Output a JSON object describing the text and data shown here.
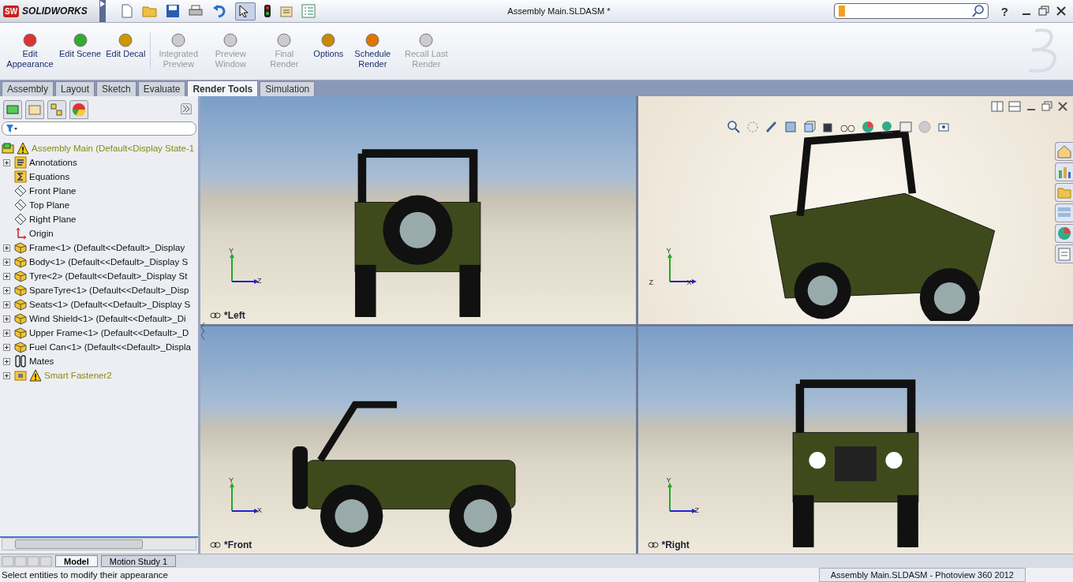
{
  "app": {
    "logo_mark": "SW",
    "logo": "SOLIDWORKS"
  },
  "window": {
    "title": "Assembly Main.SLDASM *",
    "help": "?"
  },
  "ribbon": [
    {
      "label": "Edit Appearance",
      "kind": "appearance",
      "disabled": false
    },
    {
      "label": "Edit Scene",
      "kind": "scene",
      "disabled": false
    },
    {
      "label": "Edit Decal",
      "kind": "decal",
      "disabled": false
    },
    {
      "label": "Integrated Preview",
      "kind": "preview",
      "disabled": true
    },
    {
      "label": "Preview Window",
      "kind": "window",
      "disabled": true
    },
    {
      "label": "Final Render",
      "kind": "render",
      "disabled": true
    },
    {
      "label": "Options",
      "kind": "options",
      "disabled": false
    },
    {
      "label": "Schedule Render",
      "kind": "schedule",
      "disabled": false
    },
    {
      "label": "Recall Last Render",
      "kind": "recall",
      "disabled": true
    }
  ],
  "command_tabs": [
    {
      "label": "Assembly",
      "selected": false
    },
    {
      "label": "Layout",
      "selected": false
    },
    {
      "label": "Sketch",
      "selected": false
    },
    {
      "label": "Evaluate",
      "selected": false
    },
    {
      "label": "Render Tools",
      "selected": true
    },
    {
      "label": "Simulation",
      "selected": false
    }
  ],
  "tree": {
    "root": {
      "label": "Assembly Main  (Default<Display State-1",
      "warning": true
    },
    "items": [
      {
        "label": "Annotations",
        "kind": "annotations",
        "expandable": true,
        "warning": false
      },
      {
        "label": "Equations",
        "kind": "equations",
        "expandable": false,
        "warning": false
      },
      {
        "label": "Front Plane",
        "kind": "plane",
        "expandable": false,
        "warning": false
      },
      {
        "label": "Top Plane",
        "kind": "plane",
        "expandable": false,
        "warning": false
      },
      {
        "label": "Right Plane",
        "kind": "plane",
        "expandable": false,
        "warning": false
      },
      {
        "label": "Origin",
        "kind": "origin",
        "expandable": false,
        "warning": false
      },
      {
        "label": "Frame<1> (Default<<Default>_Display",
        "kind": "part",
        "expandable": true,
        "warning": false
      },
      {
        "label": "Body<1> (Default<<Default>_Display S",
        "kind": "part",
        "expandable": true,
        "warning": false
      },
      {
        "label": "Tyre<2> (Default<<Default>_Display St",
        "kind": "part",
        "expandable": true,
        "warning": false
      },
      {
        "label": "SpareTyre<1> (Default<<Default>_Disp",
        "kind": "part",
        "expandable": true,
        "warning": false
      },
      {
        "label": "Seats<1> (Default<<Default>_Display S",
        "kind": "part",
        "expandable": true,
        "warning": false
      },
      {
        "label": "Wind Shield<1> (Default<<Default>_Di",
        "kind": "part",
        "expandable": true,
        "warning": false
      },
      {
        "label": "Upper Frame<1> (Default<<Default>_D",
        "kind": "part",
        "expandable": true,
        "warning": false
      },
      {
        "label": "Fuel Can<1> (Default<<Default>_Displa",
        "kind": "part",
        "expandable": true,
        "warning": false
      },
      {
        "label": "Mates",
        "kind": "mates",
        "expandable": true,
        "warning": false
      },
      {
        "label": "Smart Fastener2",
        "kind": "fastener",
        "expandable": true,
        "warning": true
      }
    ]
  },
  "viewports": [
    {
      "kind": "rear",
      "label": "*Left",
      "axes": [
        "Y",
        "Z"
      ]
    },
    {
      "kind": "iso",
      "axes": [
        "Y",
        "Z",
        "X"
      ]
    },
    {
      "kind": "side",
      "label": "*Front",
      "axes": [
        "Y",
        "X"
      ]
    },
    {
      "kind": "front",
      "label": "*Right",
      "axes": [
        "Y",
        "Z"
      ]
    }
  ],
  "bottom_tabs": [
    {
      "label": "Model",
      "selected": true
    },
    {
      "label": "Motion Study 1",
      "selected": false
    }
  ],
  "status_bar": {
    "message": "Select entities to modify their appearance",
    "popup": "Assembly Main.SLDASM - Photoview 360 2012"
  }
}
